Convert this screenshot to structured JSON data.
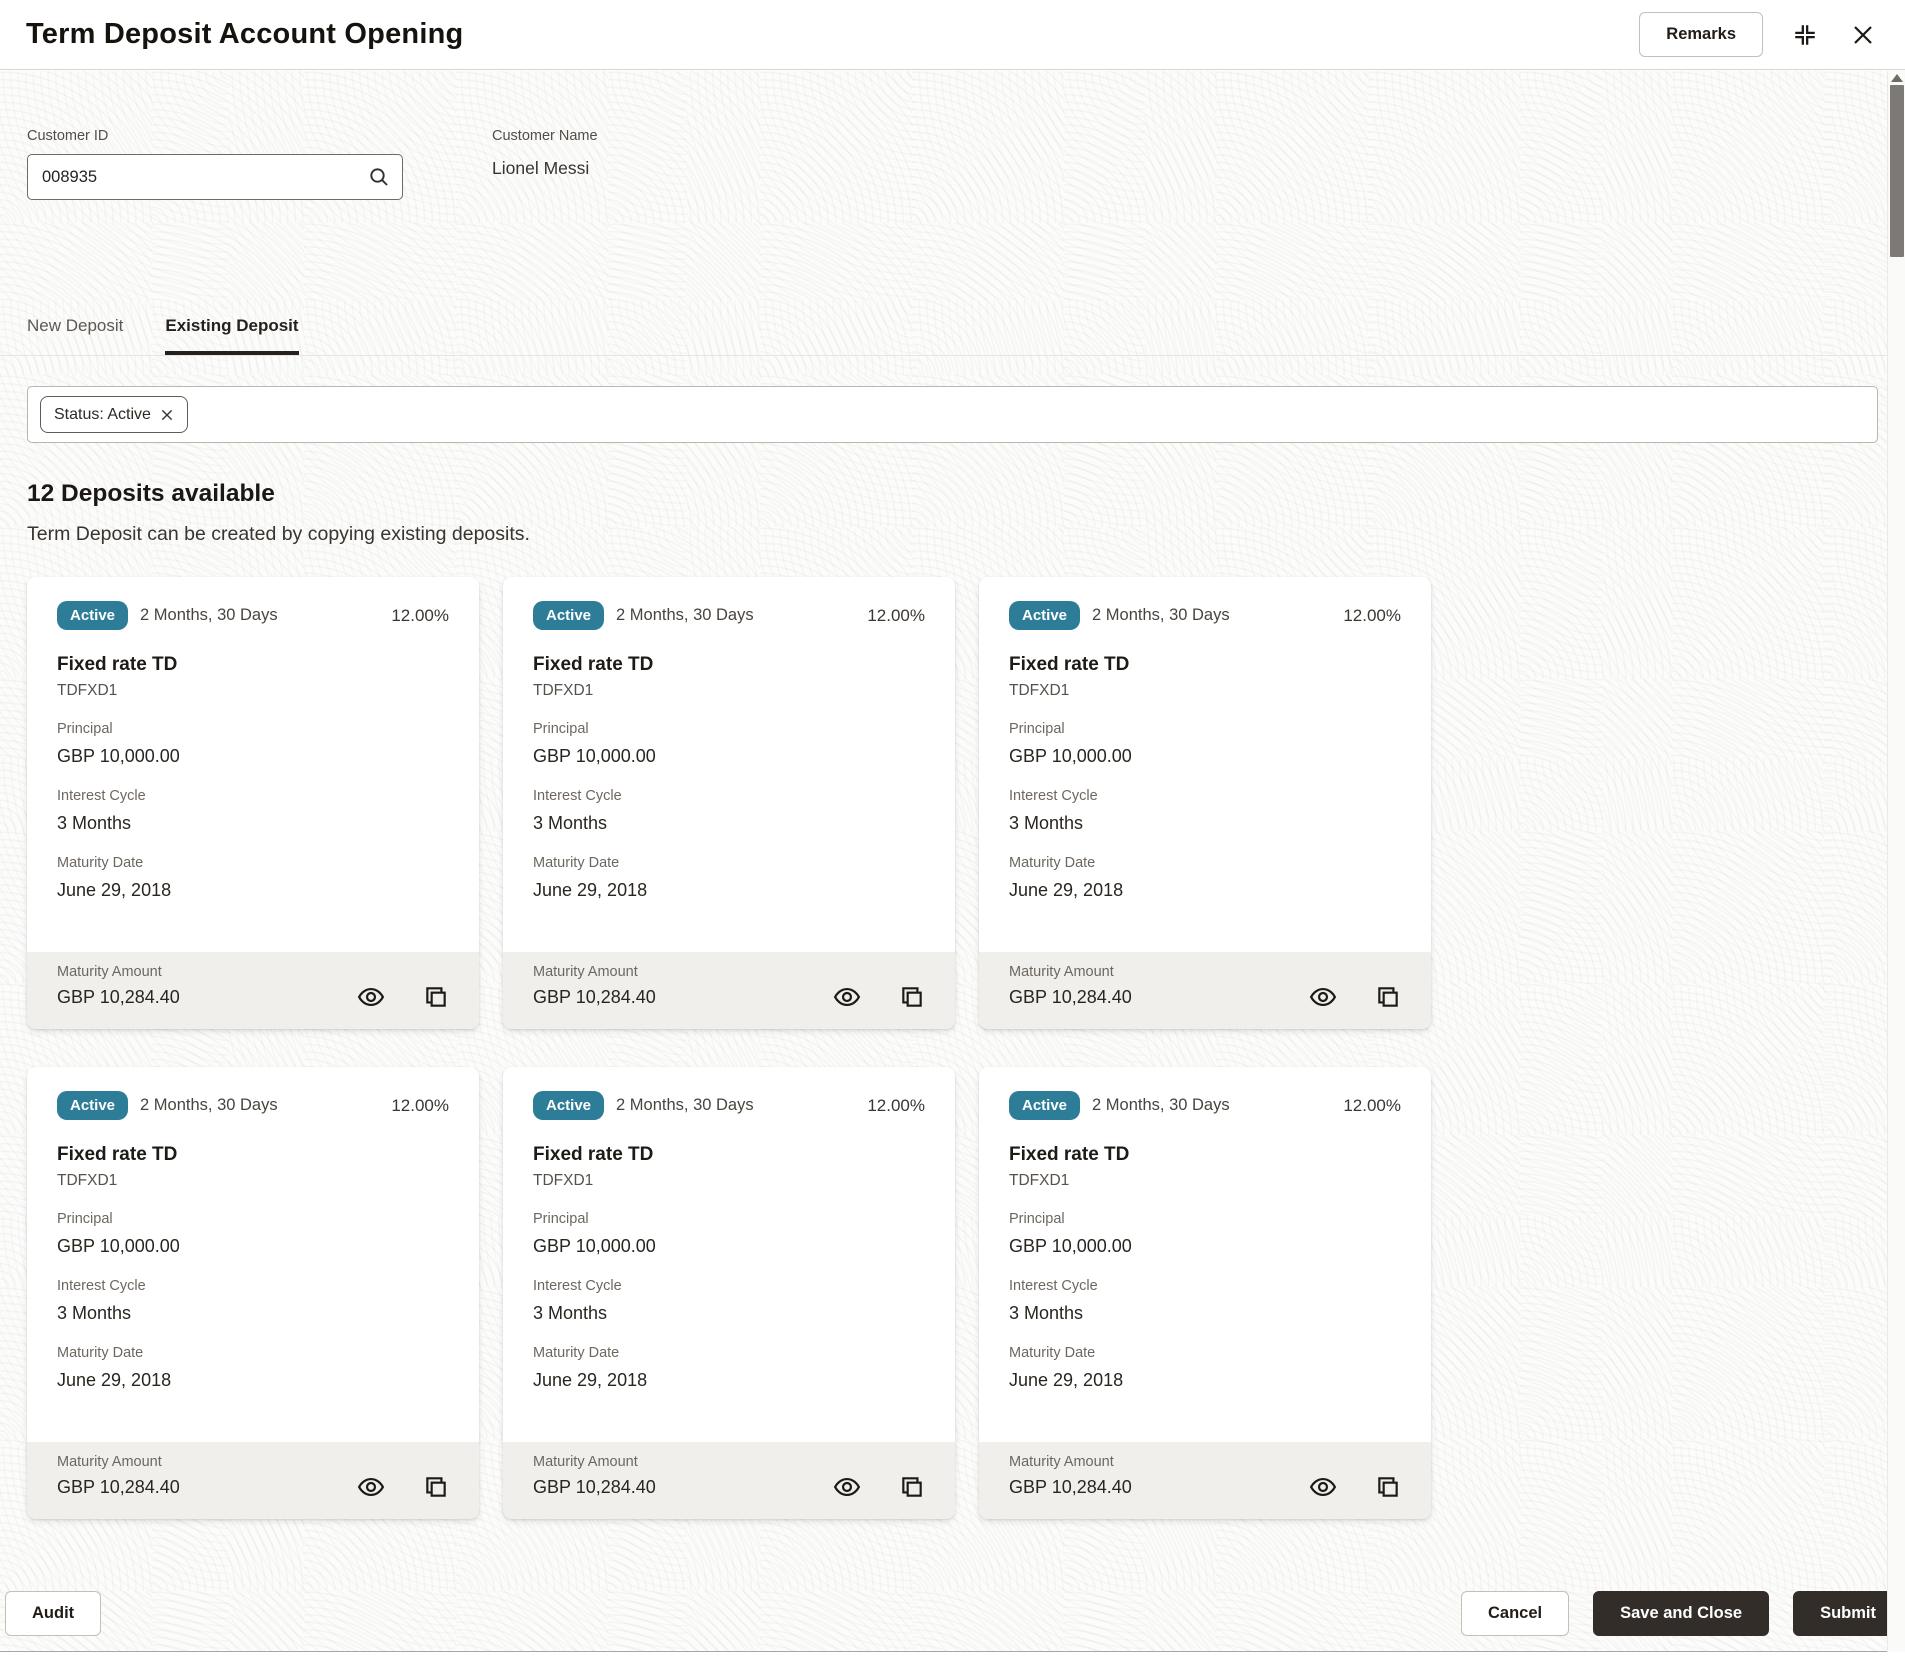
{
  "header": {
    "title": "Term Deposit Account Opening",
    "remarks_label": "Remarks"
  },
  "customer": {
    "id_label": "Customer ID",
    "id_value": "008935",
    "name_label": "Customer Name",
    "name_value": "Lionel Messi"
  },
  "tabs": [
    {
      "label": "New Deposit",
      "active": false
    },
    {
      "label": "Existing Deposit",
      "active": true
    }
  ],
  "filter": {
    "chip_label": "Status: Active"
  },
  "deposits": {
    "count_heading": "12 Deposits available",
    "subtitle": "Term Deposit can be created by copying existing deposits.",
    "card_labels": {
      "principal": "Principal",
      "interest_cycle": "Interest Cycle",
      "maturity_date": "Maturity Date",
      "maturity_amount": "Maturity Amount"
    },
    "cards": [
      {
        "status": "Active",
        "term": "2 Months, 30 Days",
        "rate": "12.00%",
        "product": "Fixed rate TD",
        "code": "TDFXD1",
        "principal": "GBP 10,000.00",
        "interest_cycle": "3 Months",
        "maturity_date": "June 29, 2018",
        "maturity_amount": "GBP 10,284.40"
      },
      {
        "status": "Active",
        "term": "2 Months, 30 Days",
        "rate": "12.00%",
        "product": "Fixed rate TD",
        "code": "TDFXD1",
        "principal": "GBP 10,000.00",
        "interest_cycle": "3 Months",
        "maturity_date": "June 29, 2018",
        "maturity_amount": "GBP 10,284.40"
      },
      {
        "status": "Active",
        "term": "2 Months, 30 Days",
        "rate": "12.00%",
        "product": "Fixed rate TD",
        "code": "TDFXD1",
        "principal": "GBP 10,000.00",
        "interest_cycle": "3 Months",
        "maturity_date": "June 29, 2018",
        "maturity_amount": "GBP 10,284.40"
      },
      {
        "status": "Active",
        "term": "2 Months, 30 Days",
        "rate": "12.00%",
        "product": "Fixed rate TD",
        "code": "TDFXD1",
        "principal": "GBP 10,000.00",
        "interest_cycle": "3 Months",
        "maturity_date": "June 29, 2018",
        "maturity_amount": "GBP 10,284.40"
      },
      {
        "status": "Active",
        "term": "2 Months, 30 Days",
        "rate": "12.00%",
        "product": "Fixed rate TD",
        "code": "TDFXD1",
        "principal": "GBP 10,000.00",
        "interest_cycle": "3 Months",
        "maturity_date": "June 29, 2018",
        "maturity_amount": "GBP 10,284.40"
      },
      {
        "status": "Active",
        "term": "2 Months, 30 Days",
        "rate": "12.00%",
        "product": "Fixed rate TD",
        "code": "TDFXD1",
        "principal": "GBP 10,000.00",
        "interest_cycle": "3 Months",
        "maturity_date": "June 29, 2018",
        "maturity_amount": "GBP 10,284.40"
      }
    ]
  },
  "page_footer": {
    "audit_label": "Audit",
    "cancel_label": "Cancel",
    "save_close_label": "Save and Close",
    "submit_label": "Submit"
  },
  "icons": {
    "search": "magnifier",
    "collapse": "four-corner-brackets",
    "close": "x-cross",
    "chip_remove": "x-cross",
    "view": "eye",
    "copy": "overlapping-squares",
    "scroll_up": "triangle-up"
  },
  "colors": {
    "badge": "#2e7d98",
    "button_dark": "#322d29",
    "card_footer": "#f1efec"
  }
}
